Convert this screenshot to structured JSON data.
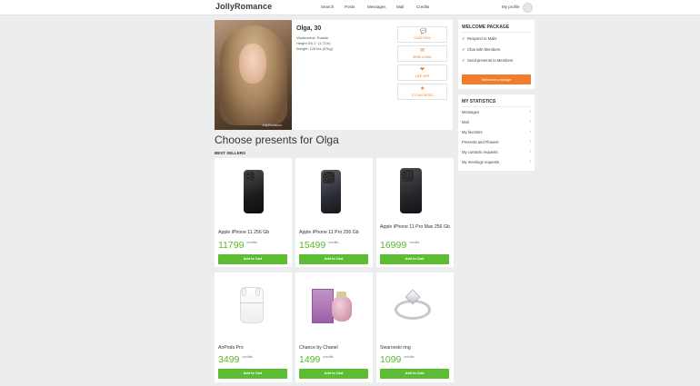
{
  "header": {
    "logo": "JollyRomance",
    "nav": [
      "Search",
      "Posts",
      "Messages",
      "Mail",
      "Credits"
    ],
    "my_profile": "My profile"
  },
  "profile": {
    "name": "Olga, 30",
    "location": "Vladivostok, Russia",
    "height": "Height 5'6.1\" (1.71m)",
    "weight": "Weight: 125 lbs (57kg)",
    "watermark": "JollyRomance",
    "actions": [
      {
        "label": "CHAT NOW",
        "icon": "chat-icon",
        "glyph": "💬"
      },
      {
        "label": "SEND A MAIL",
        "icon": "mail-icon",
        "glyph": "✉"
      },
      {
        "label": "LIKE HER",
        "icon": "heart-icon",
        "glyph": "❤"
      },
      {
        "label": "TO FAVORITES",
        "icon": "star-icon",
        "glyph": "★"
      }
    ]
  },
  "main": {
    "title": "Choose presents for Olga",
    "section": "BEST SELLERS"
  },
  "products": [
    {
      "title": "Apple iPhone 11 256 Gb",
      "price": "11799",
      "credits": "credits",
      "button": "Add to Cart",
      "image": "iphone-11-image"
    },
    {
      "title": "Apple iPhone 11 Pro 256 Gb",
      "price": "15499",
      "credits": "credits",
      "button": "Add to Cart",
      "image": "iphone-11-pro-image"
    },
    {
      "title": "Apple iPhone 11 Pro Max 256 Gb",
      "price": "16999",
      "credits": "credits",
      "button": "Add to Cart",
      "image": "iphone-11-pro-max-image"
    },
    {
      "title": "AirPods Pro",
      "price": "3499",
      "credits": "credits",
      "button": "Add to Cart",
      "image": "airpods-image"
    },
    {
      "title": "Chance by Chanel",
      "price": "1499",
      "credits": "credits",
      "button": "Add to Cart",
      "image": "perfume-image"
    },
    {
      "title": "Swarovski ring",
      "price": "1099",
      "credits": "credits",
      "button": "Add to Cart",
      "image": "ring-image"
    }
  ],
  "welcome": {
    "title": "WELCOME PACKAGE",
    "items": [
      "Respond to Mails",
      "Chat with Members",
      "Send presents to Members"
    ],
    "button": "Welcome package"
  },
  "statistics": {
    "title": "MY STATISTICS",
    "items": [
      "Messages",
      "Mail",
      "My favorites",
      "Presents and Flowers",
      "My contacts requests",
      "My meetings requests"
    ]
  },
  "colors": {
    "accent_orange": "#f07c2c",
    "cart_green": "#5cbd32",
    "price_green": "#5cb82a",
    "background": "#eceded"
  }
}
